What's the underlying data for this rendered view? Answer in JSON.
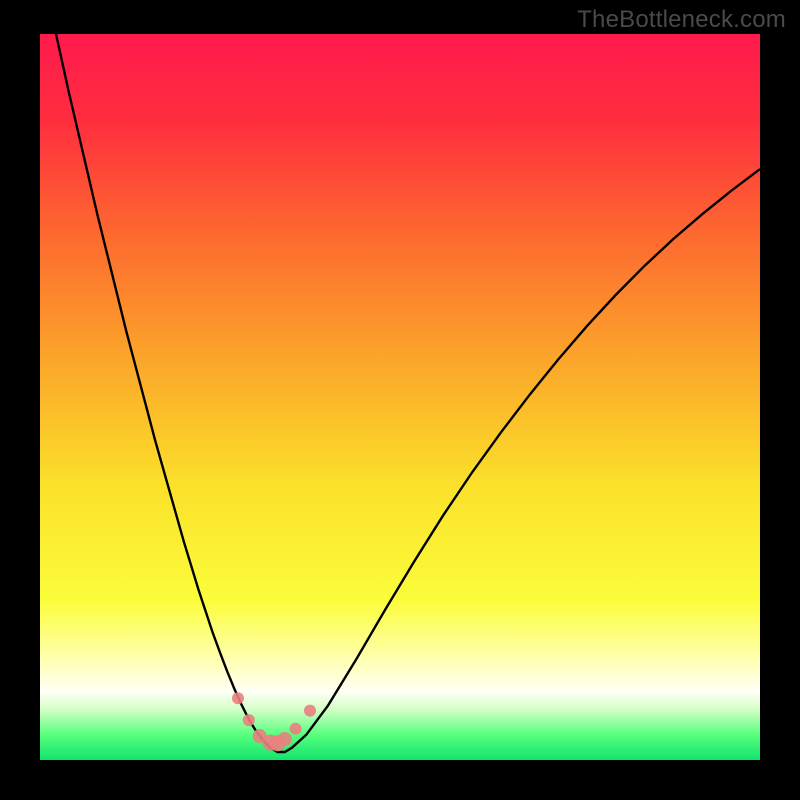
{
  "watermark": "TheBottleneck.com",
  "gradient": {
    "stops": [
      {
        "pos": 0.0,
        "color": "#ff1a4d"
      },
      {
        "pos": 0.12,
        "color": "#ff2e3e"
      },
      {
        "pos": 0.28,
        "color": "#fd6a2f"
      },
      {
        "pos": 0.45,
        "color": "#fba62a"
      },
      {
        "pos": 0.62,
        "color": "#fbe02a"
      },
      {
        "pos": 0.78,
        "color": "#fbfd3a"
      },
      {
        "pos": 0.87,
        "color": "#ffffbd"
      },
      {
        "pos": 0.905,
        "color": "#fffff6"
      },
      {
        "pos": 0.93,
        "color": "#d4ffc6"
      },
      {
        "pos": 0.965,
        "color": "#58ff7e"
      },
      {
        "pos": 1.0,
        "color": "#11e46d"
      }
    ]
  },
  "chart_data": {
    "type": "line",
    "title": "",
    "xlabel": "",
    "ylabel": "",
    "xlim": [
      0,
      100
    ],
    "ylim": [
      0,
      100
    ],
    "series": [
      {
        "name": "bottleneck-curve",
        "x": [
          0,
          2,
          4,
          6,
          8,
          10,
          12,
          14,
          16,
          18,
          20,
          22,
          24,
          25,
          26,
          27,
          28,
          29,
          30,
          31,
          32,
          33,
          34,
          35,
          37,
          40,
          44,
          48,
          52,
          56,
          60,
          64,
          68,
          72,
          76,
          80,
          84,
          88,
          92,
          96,
          100
        ],
        "y": [
          110,
          101,
          92,
          83.5,
          75,
          67,
          59,
          51.5,
          44,
          37,
          30,
          23.5,
          17.5,
          14.8,
          12.2,
          9.8,
          7.6,
          5.6,
          4.0,
          2.7,
          1.7,
          1.1,
          1.1,
          1.7,
          3.5,
          7.5,
          14,
          20.8,
          27.4,
          33.7,
          39.6,
          45.1,
          50.3,
          55.2,
          59.8,
          64.1,
          68.1,
          71.8,
          75.2,
          78.4,
          81.4
        ]
      }
    ],
    "dots": {
      "name": "marker-dots",
      "points": [
        {
          "x": 27.5,
          "y": 8.5,
          "r": 6
        },
        {
          "x": 29.0,
          "y": 5.5,
          "r": 6
        },
        {
          "x": 30.5,
          "y": 3.3,
          "r": 7
        },
        {
          "x": 32.0,
          "y": 2.4,
          "r": 8
        },
        {
          "x": 33.0,
          "y": 2.3,
          "r": 8
        },
        {
          "x": 34.0,
          "y": 2.9,
          "r": 7
        },
        {
          "x": 35.5,
          "y": 4.3,
          "r": 6
        },
        {
          "x": 37.5,
          "y": 6.8,
          "r": 6
        }
      ]
    }
  }
}
